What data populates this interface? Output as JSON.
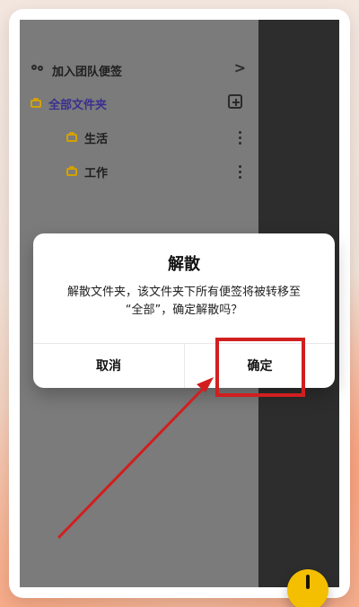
{
  "drawer": {
    "items": [
      {
        "label": "加入团队便签",
        "icon": "team-icon",
        "trailing": ">"
      },
      {
        "label": "全部文件夹",
        "icon": "folder-icon",
        "trailing_icon": "add-folder-icon"
      },
      {
        "label": "生活",
        "icon": "folder-icon",
        "trailing_icon": "more-vert-icon"
      },
      {
        "label": "工作",
        "icon": "folder-icon",
        "trailing_icon": "more-vert-icon"
      }
    ]
  },
  "dialog": {
    "title": "解散",
    "message": "解散文件夹，该文件夹下所有便签将被转移至\n“全部”，确定解散吗？",
    "cancel_label": "取消",
    "confirm_label": "确定"
  },
  "colors": {
    "folder_yellow": "#D3A100",
    "highlight_red": "#D11F1F",
    "fab_yellow": "#F3BF00"
  }
}
